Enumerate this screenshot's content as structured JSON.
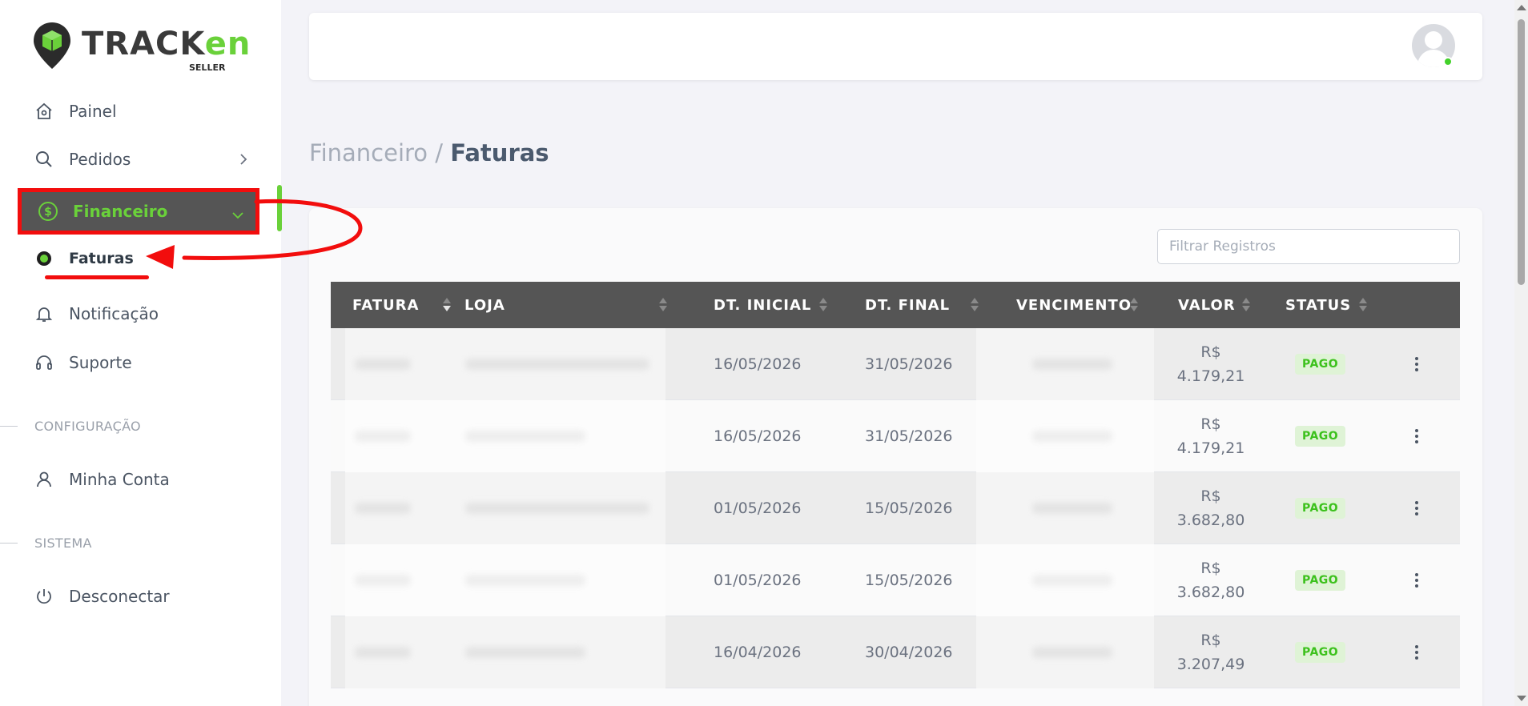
{
  "brand": {
    "name_main": "TRACK",
    "name_accent": "en",
    "subtitle": "SELLER",
    "accent_color": "#6ad13a"
  },
  "sidebar": {
    "items": [
      {
        "label": "Painel",
        "icon": "home-icon"
      },
      {
        "label": "Pedidos",
        "icon": "search-icon"
      },
      {
        "label": "Financeiro",
        "icon": "dollar-circle-icon",
        "active": true
      },
      {
        "label": "Faturas",
        "icon": "dot-icon",
        "sub": true
      },
      {
        "label": "Notificação",
        "icon": "bell-icon"
      },
      {
        "label": "Suporte",
        "icon": "headset-icon"
      },
      {
        "label": "Minha Conta",
        "icon": "user-icon"
      },
      {
        "label": "Desconectar",
        "icon": "power-icon"
      }
    ],
    "sections": {
      "config": "CONFIGURAÇÃO",
      "system": "SISTEMA"
    }
  },
  "breadcrumb": {
    "parent": "Financeiro",
    "separator": "/",
    "current": "Faturas"
  },
  "filter": {
    "placeholder": "Filtrar Registros"
  },
  "table": {
    "headers": {
      "fatura": "FATURA",
      "loja": "LOJA",
      "dt_inicial": "DT. INICIAL",
      "dt_final": "DT. FINAL",
      "vencimento": "VENCIMENTO",
      "valor": "VALOR",
      "status": "STATUS"
    },
    "rows": [
      {
        "dt_inicial": "16/05/2026",
        "dt_final": "31/05/2026",
        "valor_currency": "R$",
        "valor_amount": "4.179,21",
        "status": "PAGO"
      },
      {
        "dt_inicial": "16/05/2026",
        "dt_final": "31/05/2026",
        "valor_currency": "R$",
        "valor_amount": "4.179,21",
        "status": "PAGO"
      },
      {
        "dt_inicial": "01/05/2026",
        "dt_final": "15/05/2026",
        "valor_currency": "R$",
        "valor_amount": "3.682,80",
        "status": "PAGO"
      },
      {
        "dt_inicial": "01/05/2026",
        "dt_final": "15/05/2026",
        "valor_currency": "R$",
        "valor_amount": "3.682,80",
        "status": "PAGO"
      },
      {
        "dt_inicial": "16/04/2026",
        "dt_final": "30/04/2026",
        "valor_currency": "R$",
        "valor_amount": "3.207,49",
        "status": "PAGO"
      }
    ]
  },
  "colors": {
    "highlight": "#f20d0d",
    "header_bg": "#555555",
    "status_green": "#3cc11c"
  }
}
